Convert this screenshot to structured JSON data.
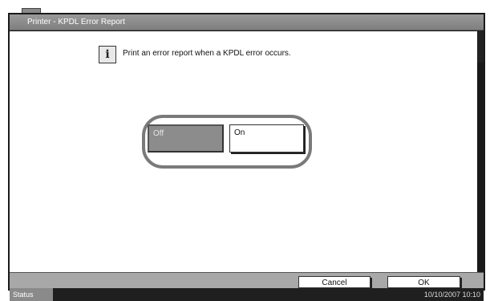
{
  "window": {
    "title": "Printer - KPDL Error Report"
  },
  "info": {
    "icon": "info-icon",
    "message": "Print an error report when a KPDL error occurs."
  },
  "toggle": {
    "selected": "Off",
    "options": [
      {
        "label": "Off"
      },
      {
        "label": "On"
      }
    ]
  },
  "buttons": {
    "cancel": "Cancel",
    "ok": "OK"
  },
  "status": {
    "label": "Status",
    "datetime": "10/10/2007   10:10"
  },
  "colors": {
    "selected_option": "#8c8c8c",
    "frame": "#1a1a1a"
  }
}
